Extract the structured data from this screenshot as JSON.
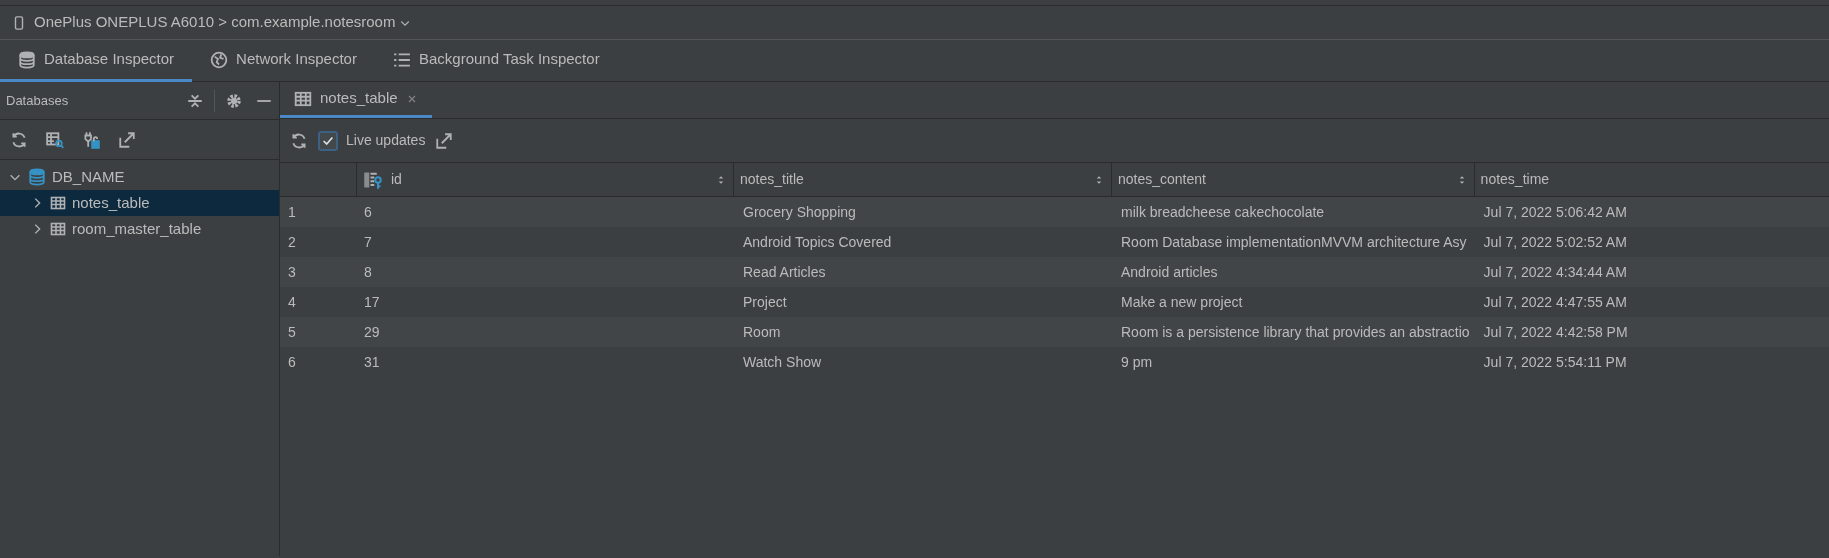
{
  "device_bar": {
    "device": "OnePlus ONEPLUS A6010 > com.example.notesroom"
  },
  "inspector_tabs": [
    {
      "label": "Database Inspector",
      "kind": "database",
      "selected": true
    },
    {
      "label": "Network Inspector",
      "kind": "globe",
      "selected": false
    },
    {
      "label": "Background Task Inspector",
      "kind": "list",
      "selected": false
    }
  ],
  "databases_panel": {
    "title": "Databases",
    "tree": [
      {
        "label": "DB_NAME",
        "kind": "database",
        "expanded": true,
        "selected": false,
        "children": [
          {
            "label": "notes_table",
            "kind": "table",
            "expanded": false,
            "selected": true
          },
          {
            "label": "room_master_table",
            "kind": "table",
            "expanded": false,
            "selected": false
          }
        ]
      }
    ]
  },
  "editor_tabs": [
    {
      "label": "notes_table",
      "selected": true
    }
  ],
  "toolbar": {
    "live_updates": {
      "label": "Live updates",
      "checked": true
    }
  },
  "table": {
    "columns": [
      {
        "label": "id",
        "primary_key": true,
        "sortable": true
      },
      {
        "label": "notes_title",
        "primary_key": false,
        "sortable": true
      },
      {
        "label": "notes_content",
        "primary_key": false,
        "sortable": true
      },
      {
        "label": "notes_time",
        "primary_key": false,
        "sortable": false
      }
    ],
    "rows": [
      {
        "row_number": "1",
        "cells": [
          "6",
          "Grocery Shopping",
          "milk breadcheese cakechocolate",
          "Jul 7, 2022 5:06:42 AM"
        ]
      },
      {
        "row_number": "2",
        "cells": [
          "7",
          "Android Topics Covered",
          "Room Database implementationMVVM architecture Asy",
          "Jul 7, 2022 5:02:52 AM"
        ]
      },
      {
        "row_number": "3",
        "cells": [
          "8",
          "Read Articles",
          "Android articles",
          "Jul 7, 2022 4:34:44 AM"
        ]
      },
      {
        "row_number": "4",
        "cells": [
          "17",
          "Project",
          "Make a new project",
          "Jul 7, 2022 4:47:55 AM"
        ]
      },
      {
        "row_number": "5",
        "cells": [
          "29",
          "Room",
          "Room is a persistence library that provides an abstractio",
          "Jul 7, 2022 4:42:58 PM"
        ]
      },
      {
        "row_number": "6",
        "cells": [
          "31",
          "Watch Show",
          "9 pm",
          "Jul 7, 2022 5:54:11 PM"
        ]
      }
    ]
  }
}
